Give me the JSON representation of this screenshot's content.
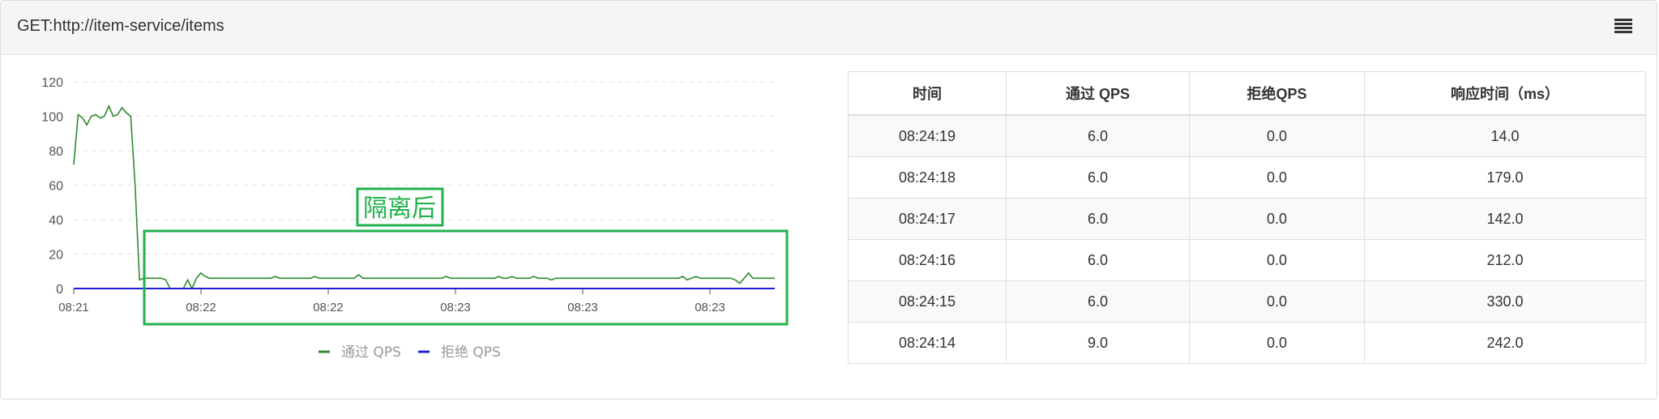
{
  "header": {
    "title": "GET:http://item-service/items",
    "menu_icon": "hamburger-menu-icon"
  },
  "chart_data": {
    "type": "line",
    "x_tick_labels": [
      "08:21",
      "08:22",
      "08:22",
      "08:23",
      "08:23",
      "08:23"
    ],
    "y_ticks": [
      0,
      20,
      40,
      60,
      80,
      100,
      120
    ],
    "ylim": [
      0,
      120
    ],
    "grid": true,
    "legend_position": "bottom",
    "series": [
      {
        "name": "通过 QPS",
        "color": "#2e8b2e",
        "values": [
          72,
          101,
          99,
          95,
          100,
          101,
          99,
          100,
          106,
          100,
          101,
          105,
          102,
          100,
          60,
          5,
          6,
          6,
          6,
          6,
          6,
          5,
          0,
          0,
          0,
          0,
          5,
          0,
          6,
          9,
          7,
          6,
          6,
          6,
          6,
          6,
          6,
          6,
          6,
          6,
          6,
          6,
          6,
          6,
          6,
          6,
          7,
          6,
          6,
          6,
          6,
          6,
          6,
          6,
          6,
          7,
          6,
          6,
          6,
          6,
          6,
          6,
          6,
          6,
          6,
          8,
          6,
          6,
          6,
          6,
          6,
          6,
          6,
          6,
          6,
          6,
          6,
          6,
          6,
          6,
          6,
          6,
          6,
          6,
          6,
          7,
          6,
          6,
          6,
          6,
          6,
          6,
          6,
          6,
          6,
          6,
          6,
          7,
          6,
          6,
          7,
          6,
          6,
          6,
          6,
          7,
          6,
          6,
          6,
          5,
          6,
          6,
          6,
          6,
          6,
          6,
          6,
          6,
          6,
          6,
          6,
          6,
          6,
          6,
          6,
          6,
          6,
          6,
          6,
          6,
          6,
          6,
          6,
          6,
          6,
          6,
          6,
          6,
          6,
          7,
          5,
          6,
          7,
          6,
          6,
          6,
          6,
          6,
          6,
          6,
          6,
          5,
          3,
          6,
          9,
          6,
          6,
          6,
          6,
          6,
          6
        ]
      },
      {
        "name": "拒绝 QPS",
        "color": "#1f1fd8",
        "values": [
          0,
          0
        ]
      }
    ]
  },
  "annotation": {
    "label": "隔离后",
    "color": "#22b14c"
  },
  "table": {
    "headers": [
      "时间",
      "通过 QPS",
      "拒绝QPS",
      "响应时间（ms）"
    ],
    "rows": [
      [
        "08:24:19",
        "6.0",
        "0.0",
        "14.0"
      ],
      [
        "08:24:18",
        "6.0",
        "0.0",
        "179.0"
      ],
      [
        "08:24:17",
        "6.0",
        "0.0",
        "142.0"
      ],
      [
        "08:24:16",
        "6.0",
        "0.0",
        "212.0"
      ],
      [
        "08:24:15",
        "6.0",
        "0.0",
        "330.0"
      ],
      [
        "08:24:14",
        "9.0",
        "0.0",
        "242.0"
      ]
    ]
  }
}
